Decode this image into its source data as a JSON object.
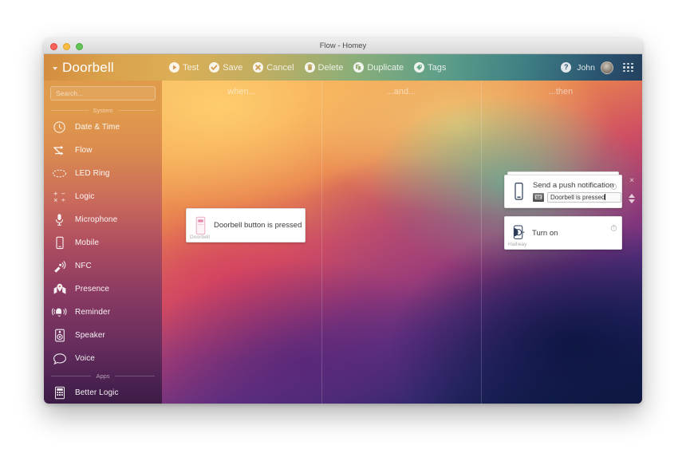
{
  "window": {
    "title": "Flow - Homey",
    "traffic_lights": [
      "close",
      "minimize",
      "maximize"
    ]
  },
  "toolbar": {
    "flow_name": "Doorbell",
    "caret_icon": "chevron-down-icon",
    "actions": [
      {
        "label": "Test",
        "icon": "play-icon"
      },
      {
        "label": "Save",
        "icon": "check-icon"
      },
      {
        "label": "Cancel",
        "icon": "x-icon"
      },
      {
        "label": "Delete",
        "icon": "trash-icon"
      },
      {
        "label": "Duplicate",
        "icon": "copy-icon"
      },
      {
        "label": "Tags",
        "icon": "tag-icon"
      }
    ],
    "help_label": "?",
    "user_name": "John",
    "avatar_icon": "avatar",
    "apps_grid_icon": "grid-icon"
  },
  "sidebar": {
    "search_placeholder": "Search...",
    "sections": [
      {
        "title": "System",
        "items": [
          {
            "label": "Date & Time",
            "icon": "clock-icon"
          },
          {
            "label": "Flow",
            "icon": "flow-arrows-icon"
          },
          {
            "label": "LED Ring",
            "icon": "led-ring-icon"
          },
          {
            "label": "Logic",
            "icon": "math-operators-icon"
          },
          {
            "label": "Microphone",
            "icon": "microphone-icon"
          },
          {
            "label": "Mobile",
            "icon": "mobile-phone-icon"
          },
          {
            "label": "NFC",
            "icon": "nfc-icon"
          },
          {
            "label": "Presence",
            "icon": "map-pin-icon"
          },
          {
            "label": "Reminder",
            "icon": "bell-ringing-icon"
          },
          {
            "label": "Speaker",
            "icon": "speaker-icon"
          },
          {
            "label": "Voice",
            "icon": "speech-bubble-icon"
          }
        ]
      },
      {
        "title": "Apps",
        "items": [
          {
            "label": "Better Logic",
            "icon": "calculator-icon"
          }
        ]
      }
    ]
  },
  "canvas": {
    "columns": [
      {
        "id": "when",
        "header": "when..."
      },
      {
        "id": "and",
        "header": "...and..."
      },
      {
        "id": "then",
        "header": "...then"
      }
    ],
    "cards": {
      "trigger": {
        "device": "Doorbell",
        "text": "Doorbell button is pressed",
        "icon": "doorbell-device-icon"
      },
      "push": {
        "title": "Send a push notification",
        "input_value": "Doorbell is pressed",
        "icon": "mobile-phone-icon",
        "tag_icon": "tag-token-icon",
        "delay_icon": "stopwatch-icon"
      },
      "turn_on": {
        "device": "Hallway",
        "text": "Turn on",
        "icon": "wall-socket-icon",
        "delay_icon": "stopwatch-icon"
      }
    },
    "card_controls": {
      "remove_label": "×",
      "move_up_icon": "arrow-up-icon",
      "move_down_icon": "arrow-down-icon"
    }
  },
  "colors": {
    "accent_orange": "#e09a4b",
    "accent_magenta": "#ab4b60",
    "accent_navy": "#23405f",
    "card_bg": "#ffffff"
  }
}
